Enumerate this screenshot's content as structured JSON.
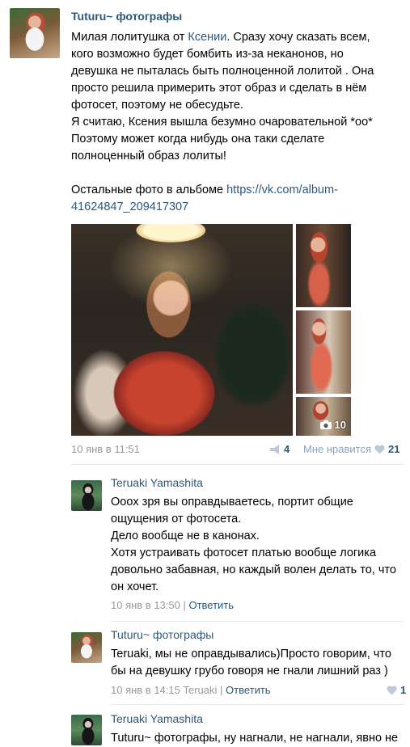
{
  "post": {
    "author": "Tuturu~ фотографы",
    "text_lines": [
      [
        "Милая лолитушка от ",
        "Ксении",
        ". Сразу хочу сказать всем,"
      ],
      [
        "кого возможно будет бомбить из-за неканонов, но"
      ],
      [
        "девушка не пыталась быть полноценной лолитой . Она"
      ],
      [
        "просто решила примерить этот образ и сделать в нём"
      ],
      [
        "фотосет, поэтому не обесудьте."
      ],
      [
        "Я считаю, Ксения вышла безумно очаровательной *оо*"
      ],
      [
        "Поэтому может когда нибудь она таки сделате"
      ],
      [
        "полноценный образ лолиты!"
      ]
    ],
    "album_prefix": "Остальные фото в альбоме ",
    "album_link_1": "https://vk.com/album-",
    "album_link_2": "41624847_209417307",
    "photo_count": "10",
    "date": "10 янв в 11:51",
    "shares": "4",
    "like_label": "Мне нравится",
    "likes": "21"
  },
  "comments": [
    {
      "author": "Teruaki Yamashita",
      "lines": [
        "Оооx зря вы оправдываетесь, портит общие",
        "ощущения от фотосета.",
        "Дело вообще не в канонах.",
        "Хотя устраивать фотосет платью вообще логика",
        "довольно забавная, но каждый волен делать то, что",
        "он хочет."
      ],
      "date": "10 янв в 13:50",
      "reply_label": "Ответить"
    },
    {
      "author": "Tuturu~ фотографы",
      "lines": [
        "Teruaki, мы не оправдывались)Просто говорим, что",
        "бы на девушку грубо говоря не гнали лишний раз )"
      ],
      "date": "10 янв в 14:15",
      "reply_to": "Teruaki",
      "reply_label": "Ответить",
      "likes": "1"
    },
    {
      "author": "Teruaki Yamashita",
      "lines": [
        "Tuturu~ фотографы, ну нагнали, не нагнали, явно не"
      ]
    }
  ],
  "colors": {
    "link": "#2b587a",
    "meta": "#999999",
    "like_icon": "#bcc9d8"
  }
}
